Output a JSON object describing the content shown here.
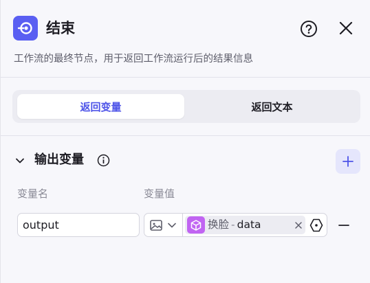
{
  "header": {
    "title": "结束",
    "description": "工作流的最终节点，用于返回工作流运行后的结果信息"
  },
  "tabs": [
    {
      "label": "返回变量",
      "active": true
    },
    {
      "label": "返回文本",
      "active": false
    }
  ],
  "output_section": {
    "title": "输出变量",
    "column_name_label": "变量名",
    "column_value_label": "变量值",
    "rows": [
      {
        "name": "output",
        "value_type_icon": "image-icon",
        "ref_node_name": "换脸",
        "ref_separator": "-",
        "ref_variable": "data"
      }
    ]
  },
  "colors": {
    "accent": "#4d53e8",
    "node_icon_bg": "#5a5ff2",
    "ref_icon_bg": "#c164f2",
    "add_button_bg": "#e5e6fc"
  }
}
